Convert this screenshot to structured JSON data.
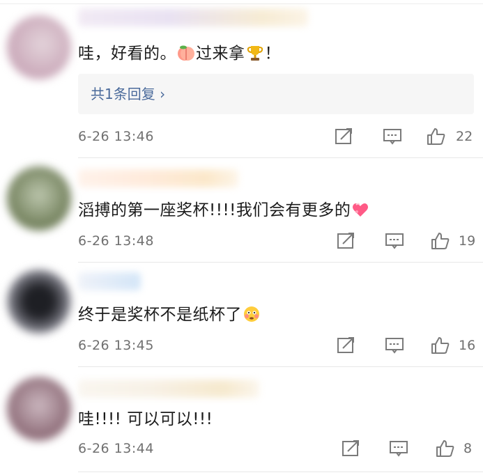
{
  "comments": [
    {
      "text_before": "哇，好看的。",
      "text_middle": "过来拿",
      "text_after": "！",
      "reply_label": "共1条回复 ›",
      "time": "6-26 13:46",
      "likes": "22",
      "avatar_colors": [
        "#c9a7b8",
        "#e3d3da"
      ],
      "name_colors": [
        "#e7dff1",
        "#f6ead0"
      ]
    },
    {
      "text": "滔搏的第一座奖杯!!!!我们会有更多的",
      "time": "6-26 13:48",
      "likes": "19",
      "avatar_colors": [
        "#6f7d58",
        "#bcc6ad"
      ],
      "name_colors": [
        "#ffe9d9",
        "#fbe6c5"
      ]
    },
    {
      "text": "终于是奖杯不是纸杯了",
      "time": "6-26 13:45",
      "likes": "16",
      "avatar_colors": [
        "#1e1f24",
        "#9a9aa5"
      ],
      "name_colors": [
        "#eef1f8",
        "#cfe3f7"
      ]
    },
    {
      "text": "哇!!!! 可以可以!!!",
      "time": "6-26 13:44",
      "likes": "8",
      "avatar_colors": [
        "#8c6a76",
        "#cbb7bf"
      ],
      "name_colors": [
        "#f7f0e4",
        "#f5e7c9"
      ]
    }
  ],
  "icons": {
    "repost": "share-icon",
    "comment": "comment-icon",
    "like": "thumbs-up-icon",
    "peach": "peach-emoji-icon",
    "trophy": "trophy-emoji-icon",
    "heart": "heart-gift-emoji-icon",
    "flushed": "flushed-face-emoji-icon"
  },
  "colors": {
    "link": "#4a6a9b",
    "meta": "#707070",
    "icon": "#7a7a7a"
  }
}
